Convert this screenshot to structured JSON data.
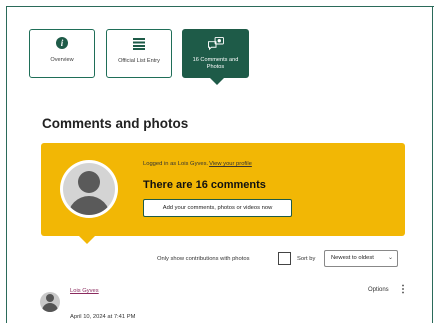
{
  "tabs": {
    "overview": "Overview",
    "official_list": "Official List Entry",
    "comments": "16 Comments and Photos"
  },
  "section": {
    "heading": "Comments and photos"
  },
  "panel": {
    "logged_in_text": "Logged in as Lois Gyves.",
    "view_profile": "View your profile",
    "count_heading": "There are 16 comments",
    "add_button": "Add your comments, photos or videos now"
  },
  "filters": {
    "only_photos_label": "Only show contributions with photos",
    "only_photos_checked": false,
    "sort_label": "Sort by",
    "sort_value": "Newest to oldest"
  },
  "comment": {
    "author": "Lois Gyves",
    "options": "Options",
    "date": "April 10, 2024 at 7:41 PM"
  },
  "colors": {
    "accent": "#1e5b48",
    "panel": "#f2b705",
    "link": "#8a2a5e"
  }
}
